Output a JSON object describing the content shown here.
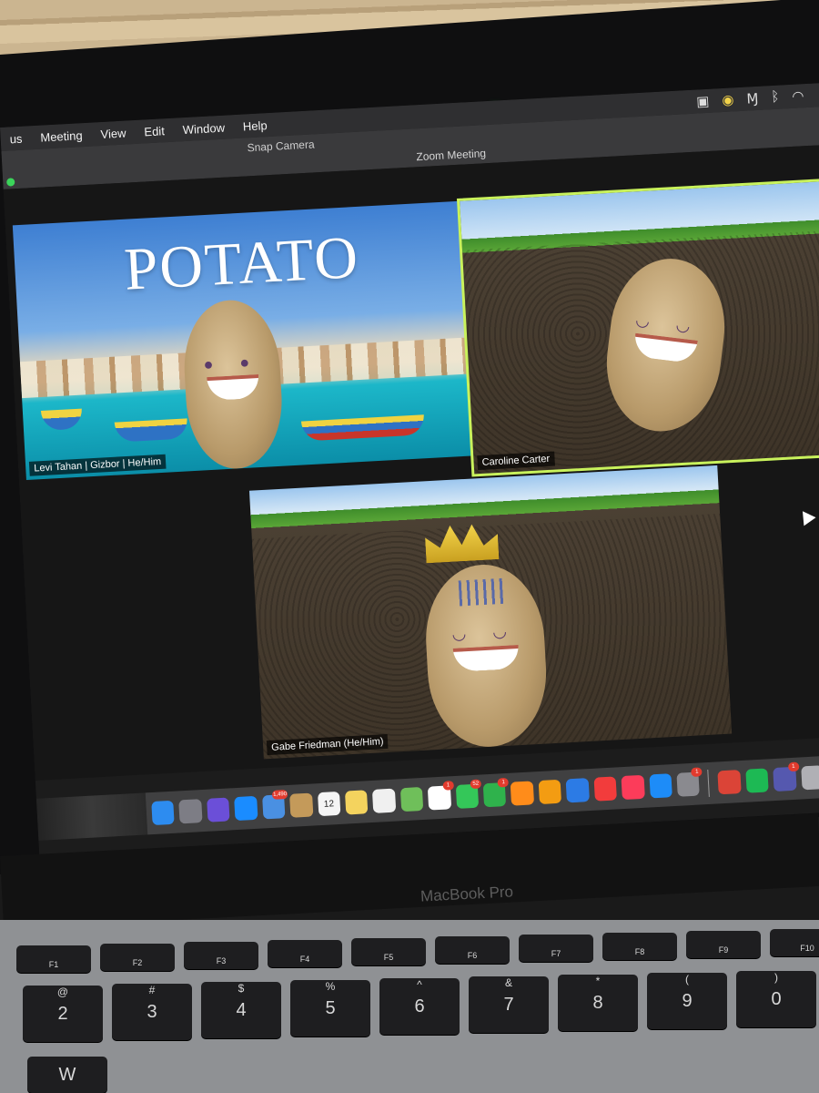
{
  "menubar": {
    "items": [
      "us",
      "Meeting",
      "View",
      "Edit",
      "Window",
      "Help"
    ],
    "status_icons": [
      "camera-icon",
      "pin-icon",
      "malwarebytes-icon",
      "bluetooth-icon",
      "wifi-icon"
    ]
  },
  "window": {
    "snap_title": "Snap Camera",
    "title": "Zoom Meeting"
  },
  "tiles": [
    {
      "name": "Levi Tahan | Gizbor | He/Him",
      "overlay": "POTATO"
    },
    {
      "name": "Caroline Carter"
    },
    {
      "name": "Gabe Friedman (He/Him)"
    }
  ],
  "dock": {
    "icons": [
      {
        "id": "finder-icon",
        "color": "#2d8cf0"
      },
      {
        "id": "launchpad-icon",
        "color": "#7d7d85"
      },
      {
        "id": "siri-icon",
        "color": "#6b4fd8"
      },
      {
        "id": "safari-icon",
        "color": "#1a8cff"
      },
      {
        "id": "mail-icon",
        "color": "#4a90e2",
        "badge": "1,490"
      },
      {
        "id": "contacts-icon",
        "color": "#c49a5a"
      },
      {
        "id": "calendar-icon",
        "color": "#f5f5f5",
        "label": "12"
      },
      {
        "id": "notes-icon",
        "color": "#f4d35e"
      },
      {
        "id": "reminders-icon",
        "color": "#f0f0f0"
      },
      {
        "id": "maps-icon",
        "color": "#6fbf5a"
      },
      {
        "id": "photos-icon",
        "color": "#ffffff",
        "badge": "1"
      },
      {
        "id": "messages-icon",
        "color": "#34c759",
        "badge": "52"
      },
      {
        "id": "facetime-icon",
        "color": "#2fb24c",
        "badge": "1"
      },
      {
        "id": "books-icon",
        "color": "#ff8c1a"
      },
      {
        "id": "pages-icon",
        "color": "#f39c12"
      },
      {
        "id": "keynote-icon",
        "color": "#2c7be5"
      },
      {
        "id": "news-icon",
        "color": "#f23c3c"
      },
      {
        "id": "music-icon",
        "color": "#fc3c5a"
      },
      {
        "id": "app-store-icon",
        "color": "#1d8cf8"
      },
      {
        "id": "system-preferences-icon",
        "color": "#8a8a8f",
        "badge": "1"
      },
      {
        "id": "chrome-icon",
        "color": "#db4437"
      },
      {
        "id": "spotify-icon",
        "color": "#1db954"
      },
      {
        "id": "teams-icon",
        "color": "#5558af",
        "badge": "1"
      },
      {
        "id": "disk-utility-icon",
        "color": "#b0b0b5"
      },
      {
        "id": "zoom-icon",
        "color": "#2d8cff"
      },
      {
        "id": "snap-camera-icon",
        "color": "#f5e04a"
      }
    ]
  },
  "laptop": {
    "brand": "MacBook Pro"
  },
  "keyboard": {
    "function_keys": [
      "F1",
      "F2",
      "F3",
      "F4",
      "F5",
      "F6",
      "F7",
      "F8",
      "F9",
      "F10"
    ],
    "number_keys": [
      {
        "top": "@",
        "main": "2"
      },
      {
        "top": "#",
        "main": "3"
      },
      {
        "top": "$",
        "main": "4"
      },
      {
        "top": "%",
        "main": "5"
      },
      {
        "top": "^",
        "main": "6"
      },
      {
        "top": "&",
        "main": "7"
      },
      {
        "top": "*",
        "main": "8"
      },
      {
        "top": "(",
        "main": "9"
      },
      {
        "top": ")",
        "main": "0"
      }
    ],
    "letter_keys": [
      "W"
    ]
  }
}
